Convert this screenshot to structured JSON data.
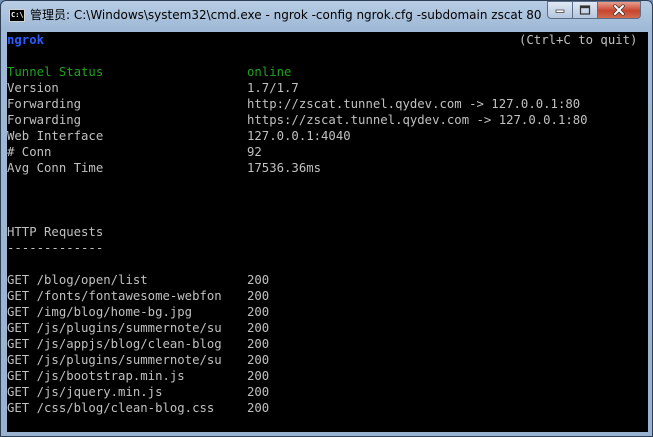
{
  "window": {
    "title": "管理员: C:\\Windows\\system32\\cmd.exe - ngrok  -config ngrok.cfg -subdomain zscat 80",
    "app_icon_text": "C:\\"
  },
  "console": {
    "app_name": "ngrok",
    "quit_hint": "(Ctrl+C to quit)",
    "status_rows": [
      {
        "label": "Tunnel Status",
        "value": "online"
      },
      {
        "label": "Version",
        "value": "1.7/1.7"
      },
      {
        "label": "Forwarding",
        "value": "http://zscat.tunnel.qydev.com -> 127.0.0.1:80"
      },
      {
        "label": "Forwarding",
        "value": "https://zscat.tunnel.qydev.com -> 127.0.0.1:80"
      },
      {
        "label": "Web Interface",
        "value": "127.0.0.1:4040"
      },
      {
        "label": "# Conn",
        "value": "92"
      },
      {
        "label": "Avg Conn Time",
        "value": "17536.36ms"
      }
    ],
    "http_heading": "HTTP Requests",
    "http_underline": "-------------",
    "requests": [
      {
        "request": "GET /blog/open/list",
        "status": "200"
      },
      {
        "request": "GET /fonts/fontawesome-webfon",
        "status": "200"
      },
      {
        "request": "GET /img/blog/home-bg.jpg",
        "status": "200"
      },
      {
        "request": "GET /js/plugins/summernote/su",
        "status": "200"
      },
      {
        "request": "GET /js/appjs/blog/clean-blog",
        "status": "200"
      },
      {
        "request": "GET /js/plugins/summernote/su",
        "status": "200"
      },
      {
        "request": "GET /js/bootstrap.min.js",
        "status": "200"
      },
      {
        "request": "GET /js/jquery.min.js",
        "status": "200"
      },
      {
        "request": "GET /css/blog/clean-blog.css",
        "status": "200"
      }
    ]
  }
}
